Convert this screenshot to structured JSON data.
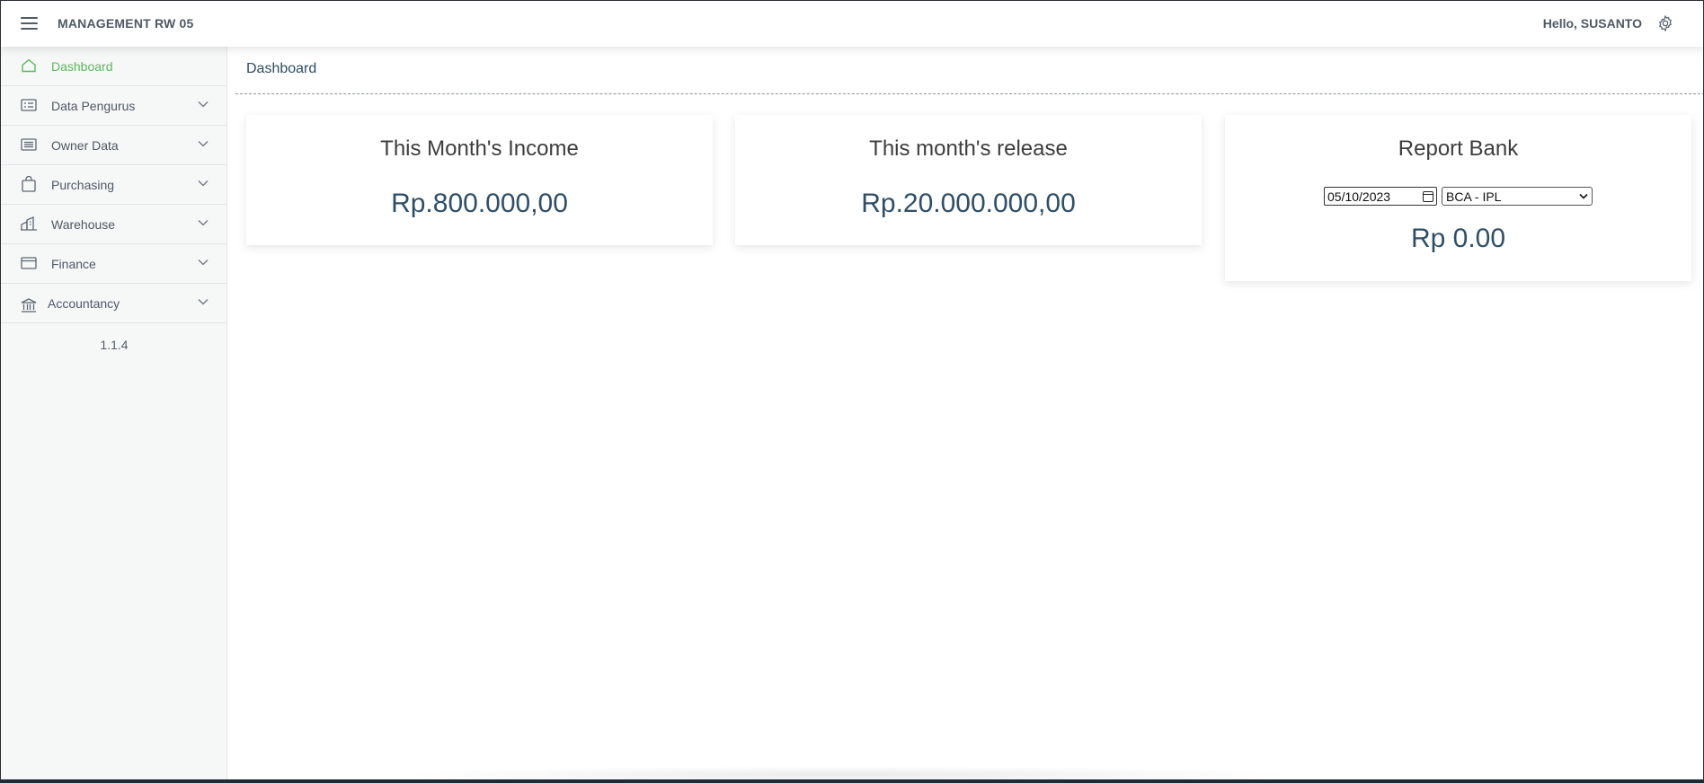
{
  "topbar": {
    "app_title": "MANAGEMENT RW 05",
    "greeting": "Hello, SUSANTO"
  },
  "sidebar": {
    "items": [
      {
        "label": "Dashboard",
        "icon": "home-icon",
        "active": true
      },
      {
        "label": "Data Pengurus",
        "icon": "id-card-icon"
      },
      {
        "label": "Owner Data",
        "icon": "list-icon"
      },
      {
        "label": "Purchasing",
        "icon": "shopping-bag-icon"
      },
      {
        "label": "Warehouse",
        "icon": "warehouse-icon"
      },
      {
        "label": "Finance",
        "icon": "wallet-icon"
      },
      {
        "label": "Accountancy",
        "icon": "bank-icon"
      }
    ],
    "version": "1.1.4"
  },
  "main": {
    "breadcrumb": "Dashboard",
    "cards": {
      "income": {
        "title": "This Month's Income",
        "value": "Rp.800.000,00"
      },
      "release": {
        "title": "This month's release",
        "value": "Rp.20.000.000,00"
      },
      "report": {
        "title": "Report Bank",
        "date_value": "05/10/2023",
        "bank_selected": "BCA - IPL",
        "total": "Rp 0.00"
      }
    }
  },
  "colors": {
    "accent_active": "#5cb85c",
    "value_text": "#2f4f69",
    "sidebar_bg": "#f6f7f7"
  }
}
